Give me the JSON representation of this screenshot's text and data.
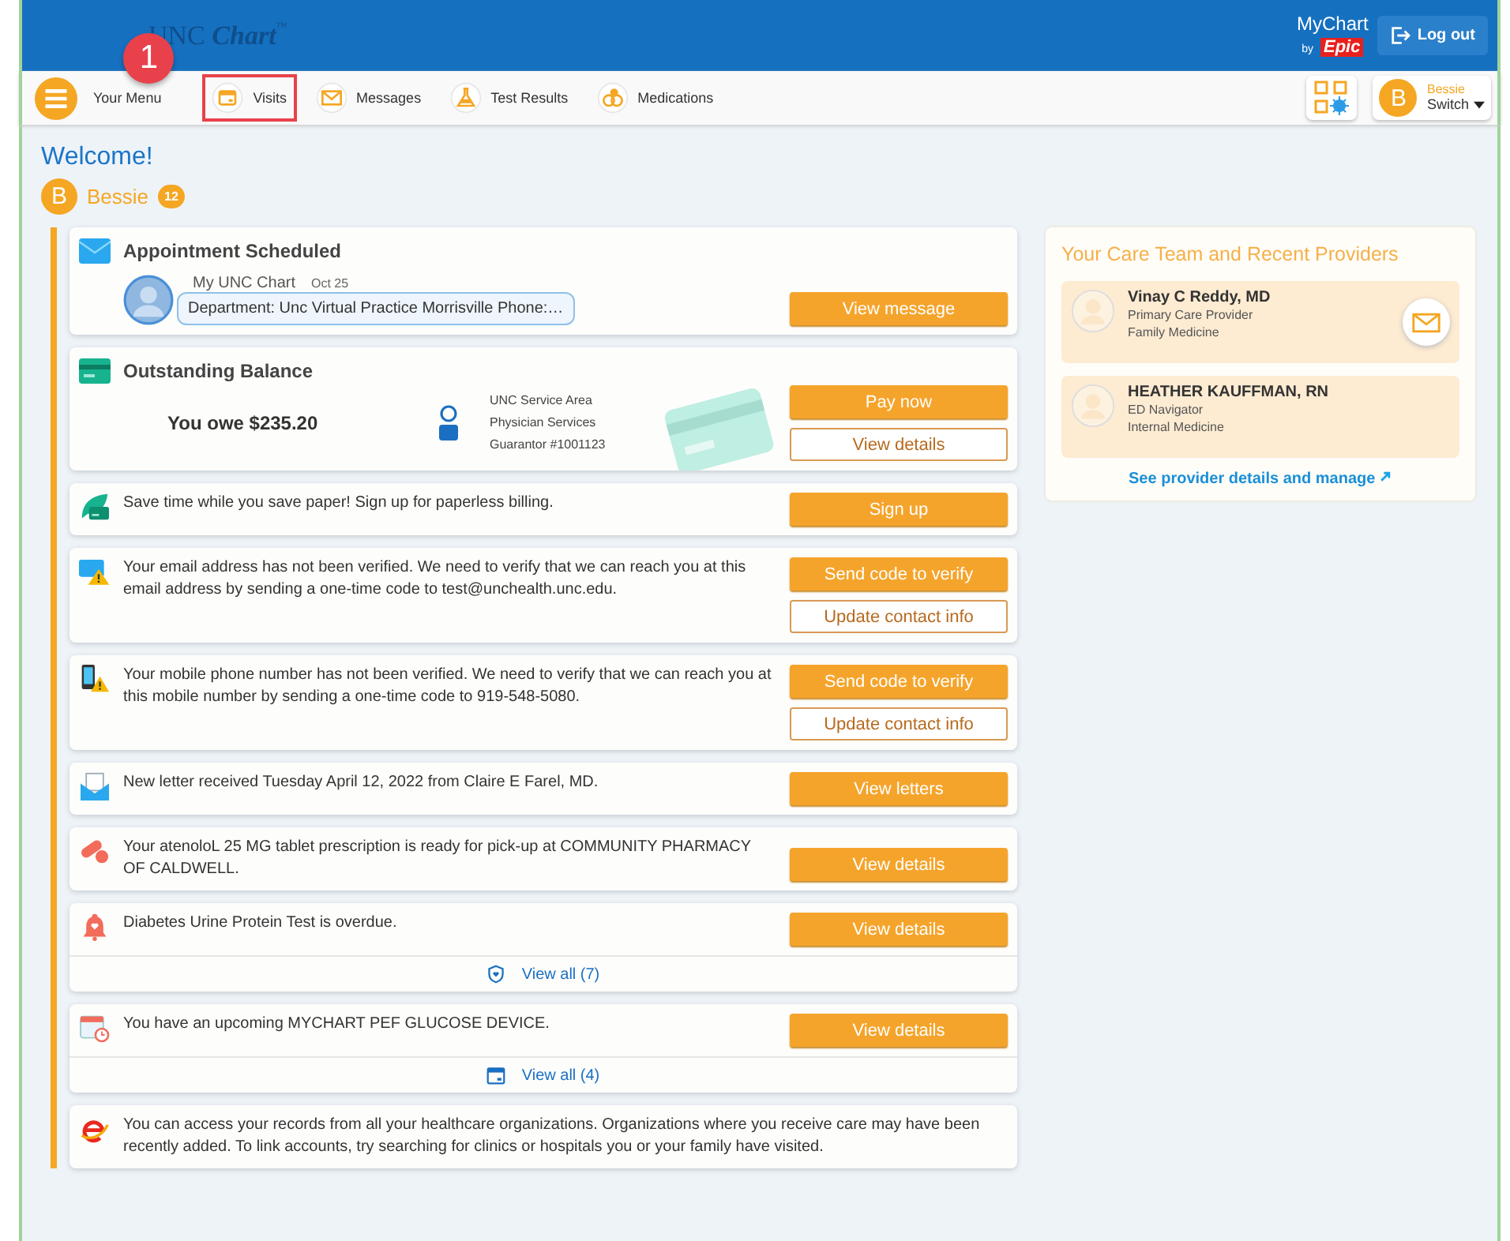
{
  "header": {
    "logo_main": "UNC",
    "logo_accent": "Chart",
    "logo_mark": "™",
    "brand_top": "MyChart",
    "brand_by": "by",
    "brand_name": "Epic",
    "logout": "Log out"
  },
  "annotation": {
    "number": "1"
  },
  "nav": {
    "menu_label": "Your Menu",
    "items": [
      {
        "label": "Visits",
        "highlighted": true
      },
      {
        "label": "Messages",
        "highlighted": false
      },
      {
        "label": "Test Results",
        "highlighted": false
      },
      {
        "label": "Medications",
        "highlighted": false
      }
    ],
    "account": {
      "initial": "B",
      "name": "Bessie",
      "switch": "Switch"
    }
  },
  "welcome": "Welcome!",
  "patient": {
    "initial": "B",
    "name": "Bessie",
    "count": "12"
  },
  "cards": [
    {
      "kind": "appointment",
      "title": "Appointment Scheduled",
      "sender": "My UNC Chart",
      "date": "Oct 25",
      "preview": "Department: Unc Virtual Practice Morrisville Phone:…",
      "buttons": [
        "View message"
      ]
    },
    {
      "kind": "balance",
      "title": "Outstanding Balance",
      "amount": "You owe $235.20",
      "account_lines": [
        "UNC Service Area",
        "Physician Services",
        "Guarantor #1001123"
      ],
      "buttons": [
        "Pay now",
        "View details"
      ]
    },
    {
      "kind": "paperless",
      "text": "Save time while you save paper! Sign up for paperless billing.",
      "buttons": [
        "Sign up"
      ]
    },
    {
      "kind": "email",
      "text": "Your email address has not been verified. We need to verify that we can reach you at this email address by sending a one-time code to test@unchealth.unc.edu.",
      "buttons": [
        "Send code to verify",
        "Update contact info"
      ]
    },
    {
      "kind": "phone",
      "text": "Your mobile phone number has not been verified. We need to verify that we can reach you at this mobile number by sending a one-time code to 919-548-5080.",
      "buttons": [
        "Send code to verify",
        "Update contact info"
      ]
    },
    {
      "kind": "letter",
      "text": "New letter received Tuesday April 12, 2022 from Claire E Farel, MD.",
      "buttons": [
        "View letters"
      ]
    },
    {
      "kind": "medication",
      "text": "Your atenoloL 25 MG tablet prescription is ready for pick-up at COMMUNITY PHARMACY OF CALDWELL.",
      "buttons": [
        "View details"
      ]
    },
    {
      "kind": "overdue",
      "text": "Diabetes Urine Protein Test is overdue.",
      "buttons": [
        "View details"
      ],
      "footer": "View all (7)"
    },
    {
      "kind": "upcoming",
      "text": "You have an upcoming MYCHART PEF GLUCOSE DEVICE.",
      "buttons": [
        "View details"
      ],
      "footer": "View all (4)"
    },
    {
      "kind": "link-accounts",
      "text": "You can access your records from all your healthcare organizations. Organizations where you receive care may have been recently added. To link accounts, try searching for clinics or hospitals you or your family have visited."
    }
  ],
  "care_team": {
    "title": "Your Care Team and Recent Providers",
    "providers": [
      {
        "name": "Vinay C Reddy, MD",
        "role": "Primary Care Provider",
        "department": "Family Medicine",
        "message_button": true
      },
      {
        "name": "HEATHER KAUFFMAN, RN",
        "role": "ED Navigator",
        "department": "Internal Medicine",
        "message_button": false
      }
    ],
    "link": "See provider details and manage"
  }
}
